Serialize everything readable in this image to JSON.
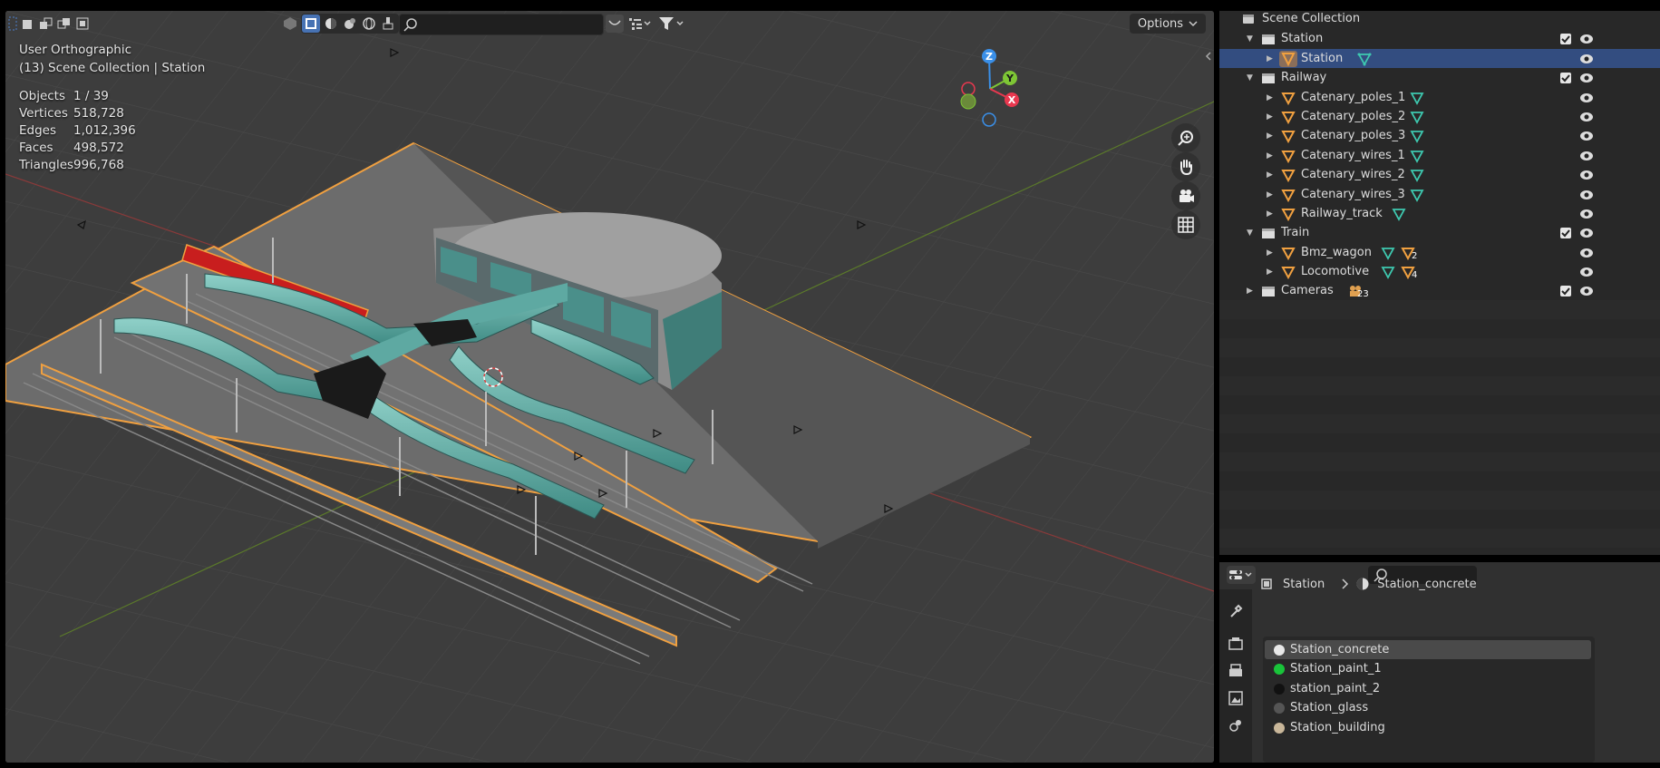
{
  "viewport": {
    "header": {
      "options_label": "Options",
      "search_placeholder": ""
    },
    "overlay": {
      "view_name": "User Orthographic",
      "collection_info": "(13) Scene Collection | Station"
    },
    "stats": [
      {
        "label": "Objects",
        "value": "1 / 39"
      },
      {
        "label": "Vertices",
        "value": "518,728"
      },
      {
        "label": "Edges",
        "value": "1,012,396"
      },
      {
        "label": "Faces",
        "value": "498,572"
      },
      {
        "label": "Triangles",
        "value": "996,768"
      }
    ],
    "gizmo": {
      "z": "Z",
      "y": "Y",
      "x": "X"
    }
  },
  "outliner": {
    "root": "Scene Collection",
    "collections": [
      {
        "name": "Station"
      },
      {
        "name": "Railway"
      },
      {
        "name": "Train"
      },
      {
        "name": "Cameras",
        "badge": "23"
      }
    ],
    "objects": {
      "station": [
        "Station"
      ],
      "railway": [
        "Catenary_poles_1",
        "Catenary_poles_2",
        "Catenary_poles_3",
        "Catenary_wires_1",
        "Catenary_wires_2",
        "Catenary_wires_3",
        "Railway_track"
      ],
      "train": [
        {
          "name": "Bmz_wagon",
          "badge": "2"
        },
        {
          "name": "Locomotive",
          "badge": "4"
        }
      ]
    }
  },
  "properties": {
    "breadcrumb_object": "Station",
    "breadcrumb_material": "Station_concrete",
    "search_placeholder": "",
    "materials": [
      {
        "name": "Station_concrete",
        "color": "#e8e8e8"
      },
      {
        "name": "Station_paint_1",
        "color": "#19c43a"
      },
      {
        "name": "station_paint_2",
        "color": "#111111"
      },
      {
        "name": "Station_glass",
        "color": "#555555"
      },
      {
        "name": "Station_building",
        "color": "#c9b79a"
      }
    ]
  },
  "colors": {
    "selection_outline": "#f0a040",
    "x_axis": "#e8384f",
    "y_axis": "#7ec635",
    "z_axis": "#3a8fe8",
    "selected_row": "#334d80"
  }
}
